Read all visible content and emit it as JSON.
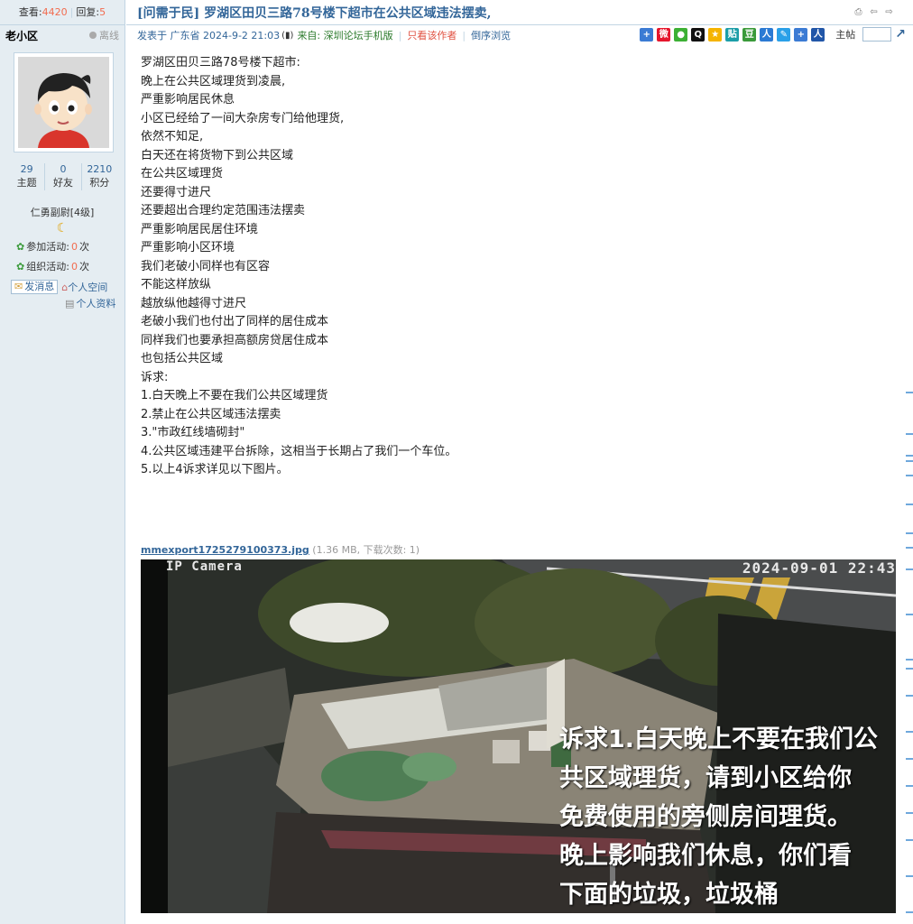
{
  "stats": {
    "views_label": "查看:",
    "views": "4420",
    "replies_label": "回复:",
    "replies": "5"
  },
  "user": {
    "name": "老小区",
    "status": "离线",
    "counts": [
      {
        "num": "29",
        "label": "主题"
      },
      {
        "num": "0",
        "label": "好友"
      },
      {
        "num": "2210",
        "label": "积分"
      }
    ],
    "rank": "仁勇副尉[4级]",
    "activities": [
      {
        "label": "参加活动:",
        "count": "0",
        "unit": "次"
      },
      {
        "label": "组织活动:",
        "count": "0",
        "unit": "次"
      }
    ],
    "send_msg": "发消息",
    "space": "个人空间",
    "profile": "个人资料"
  },
  "post": {
    "title": "[问需于民] 罗湖区田贝三路78号楼下超市在公共区域违法摆卖,",
    "posted_prefix": "发表于 广东省 2024-9-2 21:03",
    "source": "来自: 深圳论坛手机版",
    "author_only": "只看该作者",
    "reverse": "倒序浏览",
    "floor_label": "主帖",
    "lines": [
      "罗湖区田贝三路78号楼下超市:",
      "晚上在公共区域理货到凌晨,",
      "严重影响居民休息",
      "小区已经给了一间大杂房专门给他理货,",
      "依然不知足,",
      "白天还在将货物下到公共区域",
      "在公共区域理货",
      "还要得寸进尺",
      "还要超出合理约定范围违法摆卖",
      "严重影响居民居住环境",
      "严重影响小区环境",
      "我们老破小同样也有区容",
      "不能这样放纵",
      "越放纵他越得寸进尺",
      "老破小我们也付出了同样的居住成本",
      "同样我们也要承担高额房贷居住成本",
      "也包括公共区域",
      "诉求:",
      "1.白天晚上不要在我们公共区域理货",
      "2.禁止在公共区域违法摆卖",
      "3.\"市政红线墙砌封\"",
      "4.公共区域违建平台拆除，这相当于长期占了我们一个车位。",
      "5.以上4诉求详见以下图片。"
    ],
    "attachment": {
      "name": "mmexport1725279100373.jpg",
      "info": "(1.36 MB, 下载次数: 1)"
    }
  },
  "photo": {
    "camera_label": "IP Camera",
    "timestamp": "2024-09-01 22:43",
    "overlay_lines": [
      "诉求1.白天晚上不要在我们公",
      "共区域理货，请到小区给你",
      "免费使用的旁侧房间理货。",
      "晚上影响我们休息，你们看",
      "下面的垃圾，垃圾桶"
    ]
  },
  "colors": {
    "link": "#336699",
    "sidebar_bg": "#e5edf2",
    "border": "#c2d5e3",
    "highlight": "#f26c4f"
  },
  "share_icons": [
    "plus-icon",
    "weibo-icon",
    "wechat-icon",
    "qq-icon",
    "qzone-icon",
    "douban-icon",
    "tieba-icon",
    "renren-icon",
    "more-icon",
    "plus-icon",
    "people-icon"
  ]
}
